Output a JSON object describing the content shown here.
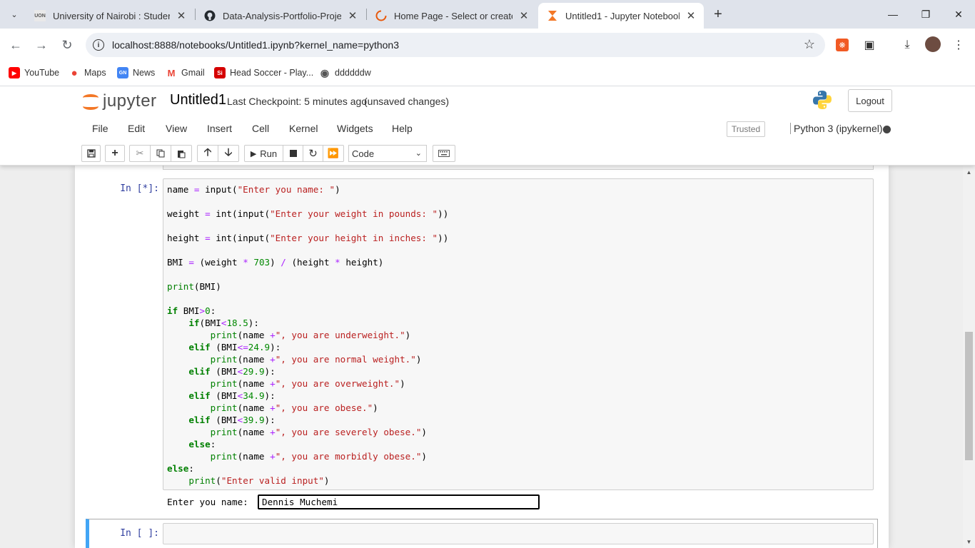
{
  "browser": {
    "tabs": [
      {
        "title": "University of Nairobi : Students",
        "favicon": "UON",
        "active": false
      },
      {
        "title": "Data-Analysis-Portfolio-Projects",
        "favicon": "github-icon",
        "active": false
      },
      {
        "title": "Home Page - Select or create a",
        "favicon": "loading-icon",
        "active": false
      },
      {
        "title": "Untitled1 - Jupyter Notebook",
        "favicon": "hourglass-icon",
        "active": true
      }
    ],
    "address": "localhost:8888/notebooks/Untitled1.ipynb?kernel_name=python3",
    "bookmarks": [
      {
        "label": "YouTube",
        "icon": "youtube-icon"
      },
      {
        "label": "Maps",
        "icon": "maps-icon"
      },
      {
        "label": "News",
        "icon": "news-icon"
      },
      {
        "label": "Gmail",
        "icon": "gmail-icon"
      },
      {
        "label": "Head Soccer - Play...",
        "icon": "head-soccer-icon"
      },
      {
        "label": "ddddddw",
        "icon": "globe-icon"
      }
    ]
  },
  "jupyter": {
    "logo_text": "jupyter",
    "notebook_name": "Untitled1",
    "checkpoint": "Last Checkpoint: 5 minutes ago",
    "status": "(unsaved changes)",
    "logout": "Logout",
    "menu": [
      "File",
      "Edit",
      "View",
      "Insert",
      "Cell",
      "Kernel",
      "Widgets",
      "Help"
    ],
    "trusted": "Trusted",
    "kernel": "Python 3 (ipykernel)",
    "run_label": "Run",
    "cell_type": "Code"
  },
  "cells": {
    "running_prompt": "In [*]:",
    "empty_prompt": "In [ ]:",
    "stdin_label": "Enter you name: ",
    "stdin_value": "Dennis Muchemi"
  },
  "colors": {
    "prompt": "#303f9f",
    "keyword": "#008000",
    "operator": "#aa22ff",
    "string": "#ba2121",
    "selected_cell_border": "#42a5f5",
    "jupyter_orange": "#f37726"
  }
}
